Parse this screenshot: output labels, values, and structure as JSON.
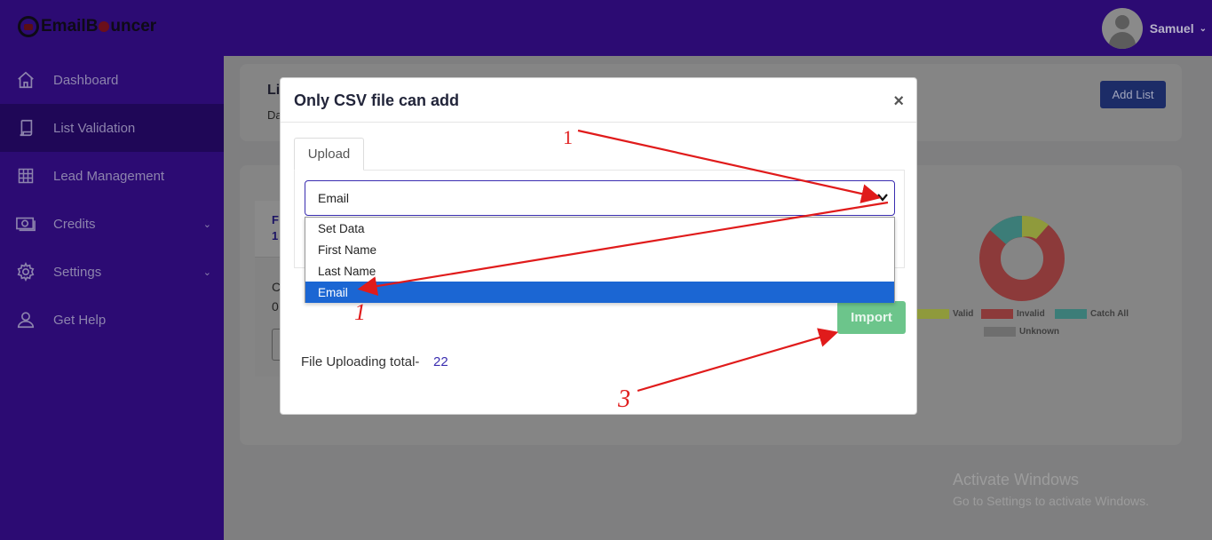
{
  "app": {
    "logo_text_before": "EmailB",
    "logo_text_after": "uncer",
    "user_name": "Samuel"
  },
  "sidebar": {
    "items": [
      {
        "label": "Dashboard",
        "icon": "home-icon"
      },
      {
        "label": "List Validation",
        "icon": "scroll-icon",
        "active": true
      },
      {
        "label": "Lead Management",
        "icon": "grid-icon"
      },
      {
        "label": "Credits",
        "icon": "money-icon",
        "has_submenu": true
      },
      {
        "label": "Settings",
        "icon": "gear-icon",
        "has_submenu": true
      },
      {
        "label": "Get Help",
        "icon": "user-icon"
      }
    ]
  },
  "background": {
    "page_title_partial": "Li",
    "subtitle_partial": "Da",
    "add_list_label": "Add List",
    "stat_partial_1": "F",
    "stat_partial_2": "1",
    "row_partial_1": "C",
    "row_partial_2": "0",
    "legend": [
      {
        "label": "Valid",
        "color": "#8f9a3c"
      },
      {
        "label": "Invalid",
        "color": "#8c3a3a"
      },
      {
        "label": "Catch All",
        "color": "#3c7d78"
      },
      {
        "label": "Unknown",
        "color": "#6e6e6e"
      }
    ],
    "watermark_title": "Activate Windows",
    "watermark_subtitle": "Go to Settings to activate Windows."
  },
  "modal": {
    "title": "Only CSV file can add",
    "close_label": "×",
    "tab_label": "Upload",
    "select_value": "Email",
    "options": [
      "Set Data",
      "First Name",
      "Last Name",
      "Email"
    ],
    "selected_option_index": 3,
    "import_label": "Import",
    "upload_total_label": "File Uploading total-",
    "upload_total_value": "22"
  },
  "annotations": {
    "step_1_top": "1",
    "step_1_bottom": "1",
    "step_3": "3",
    "color": "#e01b1b"
  }
}
